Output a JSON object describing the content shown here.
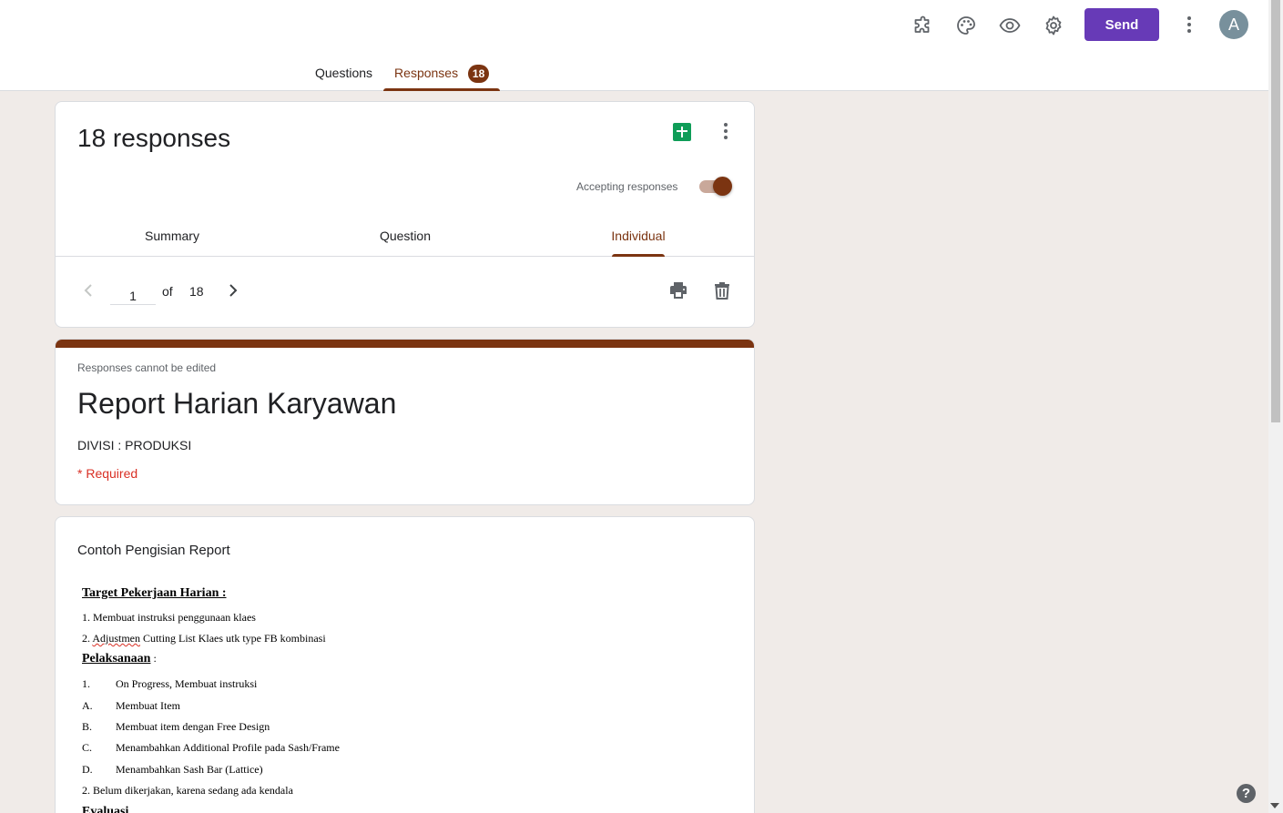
{
  "top_icons": [
    "puzzle-icon",
    "palette-icon",
    "eye-icon",
    "gear-icon"
  ],
  "send_label": "Send",
  "avatar_letter": "A",
  "main_tabs": {
    "questions": "Questions",
    "responses": "Responses",
    "responses_count": "18"
  },
  "responses_card": {
    "title": "18 responses",
    "accepting_label": "Accepting responses",
    "accepting_on": true,
    "sub_tabs": {
      "summary": "Summary",
      "question": "Question",
      "individual": "Individual"
    },
    "pager": {
      "current": "1",
      "of_label": "of",
      "total": "18"
    }
  },
  "form_header": {
    "notice": "Responses cannot be edited",
    "title": "Report Harian Karyawan",
    "description": "DIVISI : PRODUKSI",
    "required": "* Required"
  },
  "question_card": {
    "title": "Contoh Pengisian Report",
    "heading_target": "Target Pekerjaan Harian :",
    "target_1": "1. Membuat instruksi penggunaan klaes",
    "target_2_prefix": "2. ",
    "target_2_word": "Adjustmen",
    "target_2_rest": " Cutting List Klaes utk type FB kombinasi",
    "heading_pelaksanaan": "Pelaksanaan",
    "pelaksanaan_colon": " :",
    "p1_num": "1.",
    "p1_text": "On Progress, Membuat instruksi",
    "pa_num": "A.",
    "pa_text": "Membuat Item",
    "pb_num": "B.",
    "pb_text": "Membuat item dengan Free Design",
    "pc_num": "C.",
    "pc_text": "Menambahkan Additional Profile pada Sash/Frame",
    "pd_num": "D.",
    "pd_text": "Menambahkan Sash Bar (Lattice)",
    "p2": "2. Belum dikerjakan, karena sedang ada kendala",
    "heading_evaluasi": "Evaluasi"
  },
  "help_label": "?",
  "colors": {
    "accent": "#7b3411",
    "send": "#673ab7",
    "background": "#f0ebe8",
    "sheets": "#0f9d58",
    "required": "#d93025"
  }
}
